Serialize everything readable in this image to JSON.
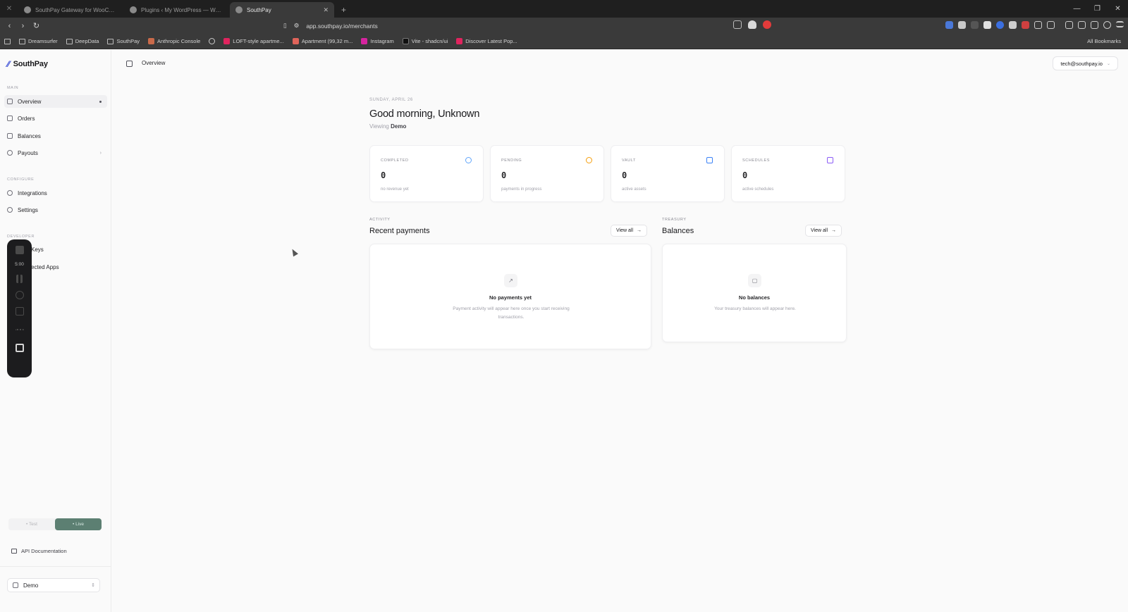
{
  "browser": {
    "tabs": [
      {
        "label": "SouthPay Gateway for WooCommer...",
        "active": false
      },
      {
        "label": "Plugins ‹ My WordPress — WordPress",
        "active": false
      },
      {
        "label": "SouthPay",
        "active": true
      }
    ],
    "new_tab": "+",
    "window_controls": {
      "minimize": "—",
      "restore": "❐",
      "close": "✕"
    },
    "address": "app.southpay.io/merchants",
    "bookmarks": [
      "Dreamsurfer",
      "DeepData",
      "SouthPay",
      "Anthropic Console",
      "",
      "LOFT-style apartme...",
      "Apartment (99,32 m...",
      "Instagram",
      "Vite - shadcn/ui",
      "Discover Latest Pop..."
    ],
    "all_bookmarks": "All Bookmarks"
  },
  "sidebar": {
    "brand": "SouthPay",
    "sections": {
      "main": "MAIN",
      "configure": "CONFIGURE",
      "developer": "DEVELOPER"
    },
    "nav": {
      "overview": "Overview",
      "orders": "Orders",
      "balances": "Balances",
      "payouts": "Payouts",
      "integrations": "Integrations",
      "settings": "Settings",
      "api_keys": "Keys",
      "connected_apps": "ected Apps"
    },
    "recorder_time": "5:00",
    "env": {
      "test": "• Test",
      "live": "• Live",
      "selected": "live"
    },
    "api_docs": "API Documentation",
    "org": "Demo"
  },
  "header": {
    "breadcrumb": "Overview",
    "user": "tech@southpay.io"
  },
  "overview": {
    "date": "SUNDAY, APRIL 26",
    "greeting": "Good morning, Unknown",
    "viewing_label": "Viewing",
    "viewing_value": "Demo",
    "stats": [
      {
        "label": "COMPLETED",
        "value": "0",
        "sub": "no revenue yet",
        "color": "#60a5fa"
      },
      {
        "label": "PENDING",
        "value": "0",
        "sub": "payments in progress",
        "color": "#f59e0b"
      },
      {
        "label": "VAULT",
        "value": "0",
        "sub": "active assets",
        "color": "#3b82f6"
      },
      {
        "label": "SCHEDULES",
        "value": "0",
        "sub": "active schedules",
        "color": "#8b5cf6"
      }
    ],
    "activity": {
      "eyebrow": "ACTIVITY",
      "title": "Recent payments",
      "view_all": "View all",
      "empty_title": "No payments yet",
      "empty_desc": "Payment activity will appear here once you start receiving transactions."
    },
    "treasury": {
      "eyebrow": "TREASURY",
      "title": "Balances",
      "view_all": "View all",
      "empty_title": "No balances",
      "empty_desc": "Your treasury balances will appear here."
    }
  },
  "colors": {
    "brand": "#3b4fd6",
    "live": "#5c7f72"
  }
}
